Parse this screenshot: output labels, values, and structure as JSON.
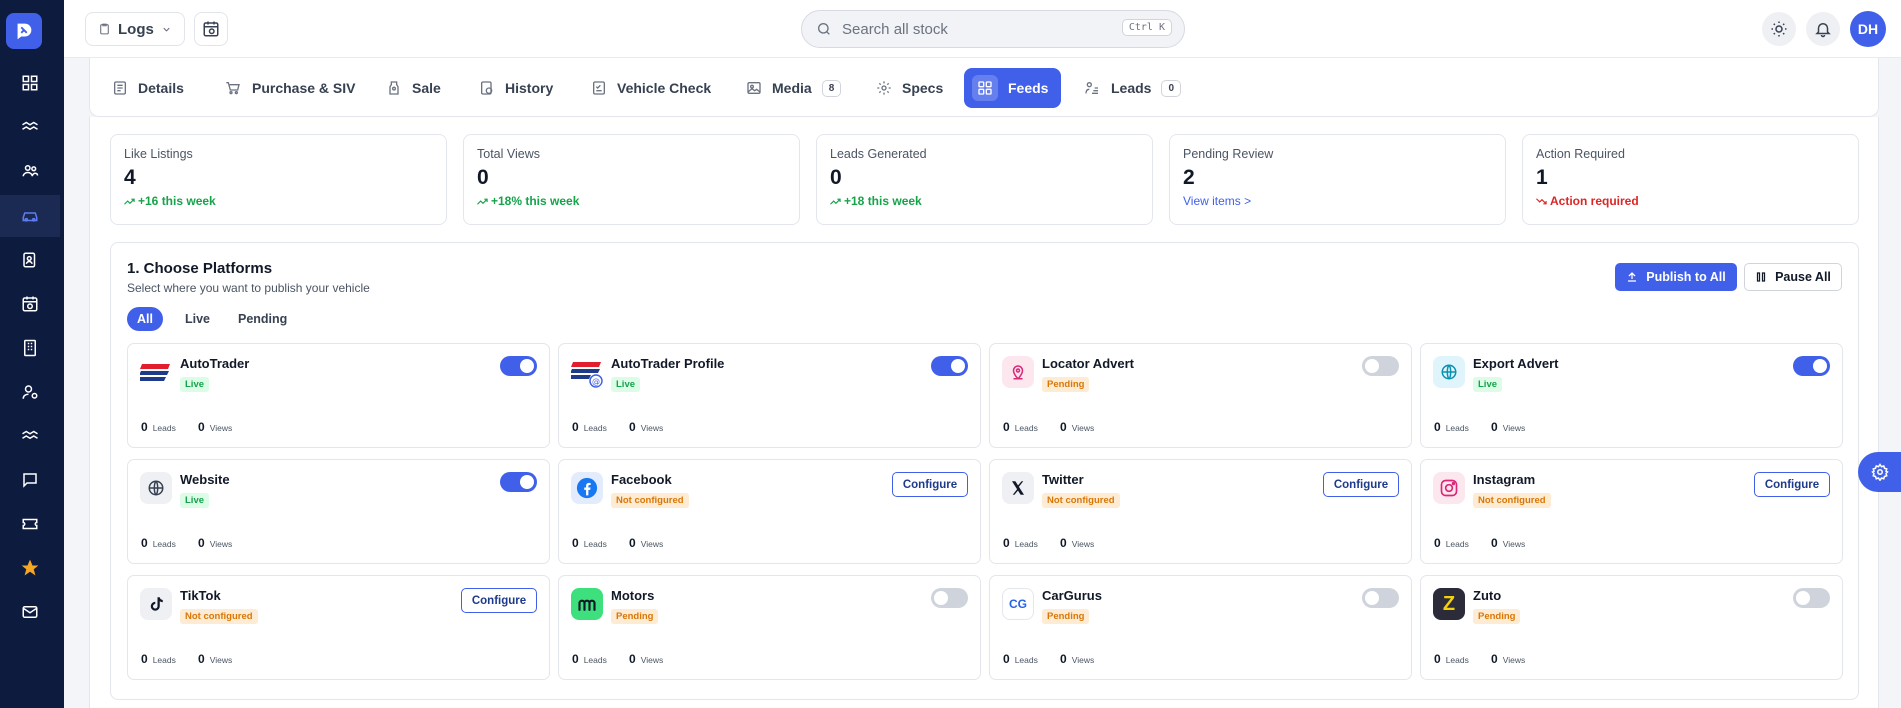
{
  "topbar": {
    "logs_label": "Logs",
    "search_placeholder": "Search all stock",
    "shortcut": "Ctrl K",
    "avatar_initials": "DH"
  },
  "tabs": [
    {
      "label": "Details"
    },
    {
      "label": "Purchase & SIV"
    },
    {
      "label": "Sale"
    },
    {
      "label": "History"
    },
    {
      "label": "Vehicle Check"
    },
    {
      "label": "Media",
      "badge": "8"
    },
    {
      "label": "Specs"
    },
    {
      "label": "Feeds",
      "active": true
    },
    {
      "label": "Leads",
      "badge": "0"
    }
  ],
  "stats": [
    {
      "label": "Like Listings",
      "value": "4",
      "sub": "+16 this week"
    },
    {
      "label": "Total Views",
      "value": "0",
      "sub": "+18% this week"
    },
    {
      "label": "Leads Generated",
      "value": "0",
      "sub": "+18 this week"
    },
    {
      "label": "Pending Review",
      "value": "2",
      "sub": "View items >"
    },
    {
      "label": "Action Required",
      "value": "1",
      "sub": "Action required"
    }
  ],
  "platforms": {
    "title": "1. Choose Platforms",
    "subtitle": "Select where you want to publish your vehicle",
    "publish_all": "Publish to All",
    "pause_all": "Pause All",
    "filters": [
      "All",
      "Live",
      "Pending"
    ],
    "leads_label": "Leads",
    "views_label": "Views",
    "configure_label": "Configure",
    "items": [
      {
        "name": "AutoTrader",
        "status": "Live",
        "leads": "0",
        "views": "0"
      },
      {
        "name": "AutoTrader Profile",
        "status": "Live",
        "leads": "0",
        "views": "0"
      },
      {
        "name": "Locator Advert",
        "status": "Pending",
        "leads": "0",
        "views": "0"
      },
      {
        "name": "Export Advert",
        "status": "Live",
        "leads": "0",
        "views": "0"
      },
      {
        "name": "Website",
        "status": "Live",
        "leads": "0",
        "views": "0"
      },
      {
        "name": "Facebook",
        "status": "Not configured",
        "leads": "0",
        "views": "0"
      },
      {
        "name": "Twitter",
        "status": "Not configured",
        "leads": "0",
        "views": "0"
      },
      {
        "name": "Instagram",
        "status": "Not configured",
        "leads": "0",
        "views": "0"
      },
      {
        "name": "TikTok",
        "status": "Not configured",
        "leads": "0",
        "views": "0"
      },
      {
        "name": "Motors",
        "status": "Pending",
        "leads": "0",
        "views": "0"
      },
      {
        "name": "CarGurus",
        "status": "Pending",
        "leads": "0",
        "views": "0",
        "logo_text": "CG"
      },
      {
        "name": "Zuto",
        "status": "Pending",
        "leads": "0",
        "views": "0",
        "logo_text": "Z"
      }
    ]
  },
  "colors": {
    "accent": "#4060ea",
    "sidebar": "#0d1b3e",
    "live": "#16a34a",
    "pending": "#d97706",
    "alert": "#dc2626"
  }
}
